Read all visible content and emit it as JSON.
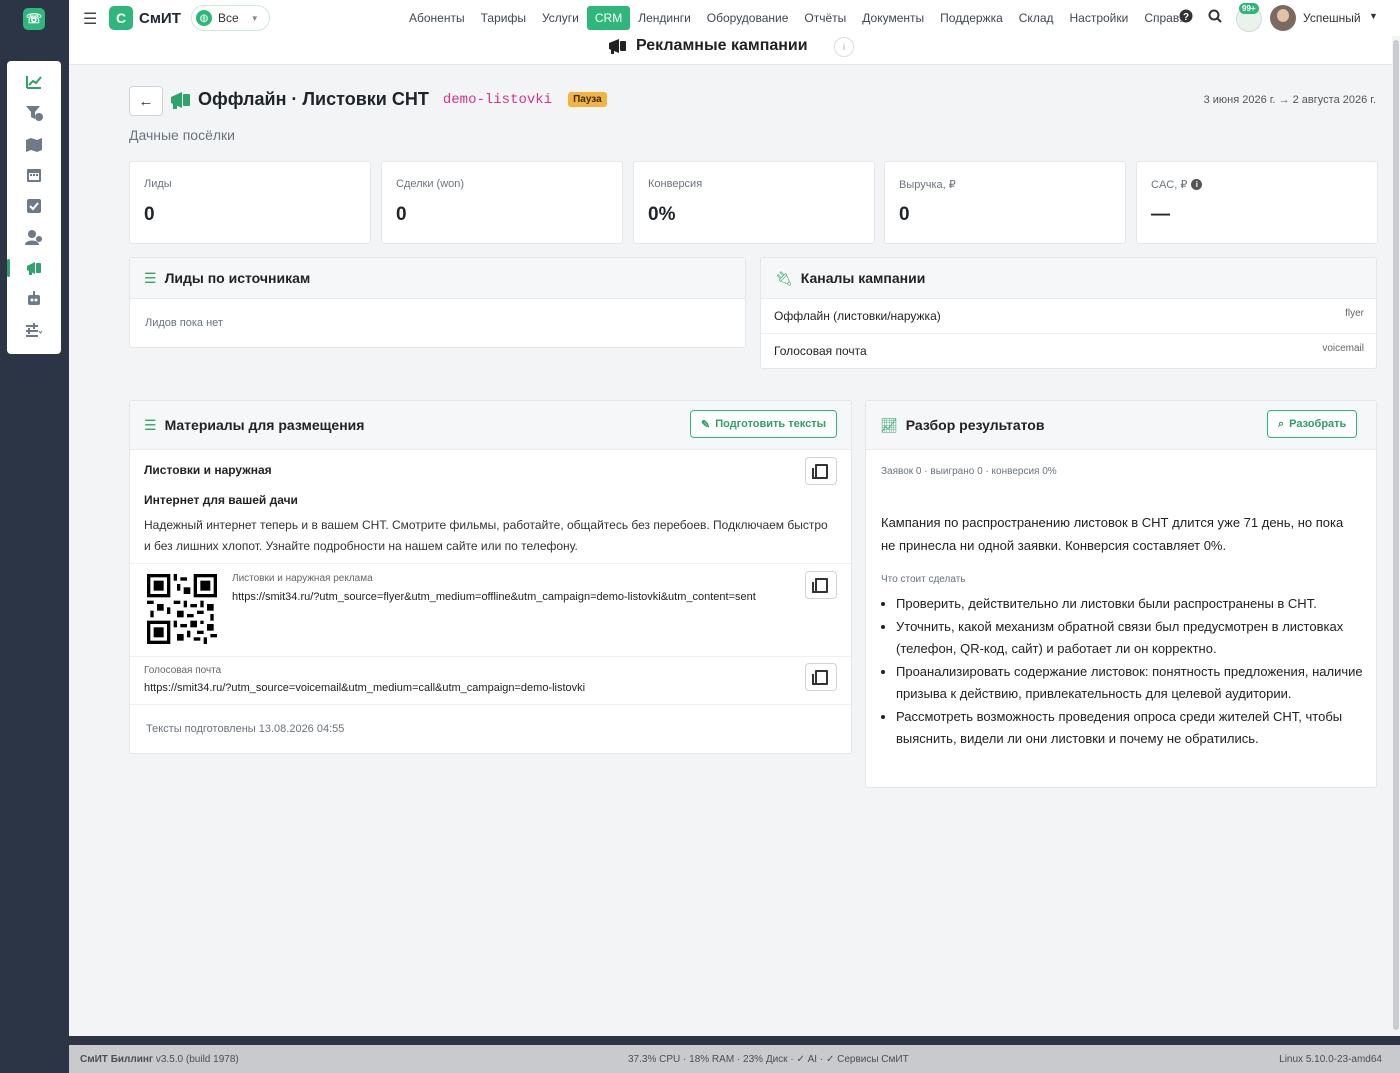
{
  "app": {
    "logo_letter": "С",
    "name": "СмИТ",
    "scope": "Все"
  },
  "nav": [
    "Абоненты",
    "Тарифы",
    "Услуги",
    "CRM",
    "Лендинги",
    "Оборудование",
    "Отчёты",
    "Документы",
    "Поддержка",
    "Склад",
    "Настройки",
    "Справ."
  ],
  "user": {
    "name": "Успешный",
    "notifications": "99+"
  },
  "page_title": "Рекламные кампании",
  "campaign": {
    "title": "Оффлайн · Листовки СНТ",
    "slug": "demo-listovki",
    "status": "Пауза",
    "dates": "3 июня 2026 г. → 2 августа 2026 г.",
    "description": "Дачные посёлки"
  },
  "kpis": [
    {
      "label": "Лиды",
      "value": "0"
    },
    {
      "label": "Сделки (won)",
      "value": "0"
    },
    {
      "label": "Конверсия",
      "value": "0%"
    },
    {
      "label": "Выручка, ₽",
      "value": "0"
    },
    {
      "label": "CAC, ₽",
      "value": "—"
    }
  ],
  "leads_by_source": {
    "title": "Лиды по источникам",
    "empty": "Лидов пока нет"
  },
  "channels": {
    "title": "Каналы кампании",
    "items": [
      {
        "name": "Оффлайн (листовки/наружка)",
        "code": "flyer"
      },
      {
        "name": "Голосовая почта",
        "code": "voicemail"
      }
    ]
  },
  "materials": {
    "title": "Материалы для размещения",
    "button": "Подготовить тексты",
    "section_title": "Листовки и наружная",
    "headline": "Интернет для вашей дачи",
    "body": "Надежный интернет теперь и в вашем СНТ. Смотрите фильмы, работайте, общайтесь без перебоев. Подключаем быстро и без лишних хлопот. Узнайте подробности на нашем сайте или по телефону.",
    "link1_label": "Листовки и наружная реклама",
    "link1_url": "https://smit34.ru/?utm_source=flyer&utm_medium=offline&utm_campaign=demo-listovki&utm_content=sent",
    "link2_label": "Голосовая почта",
    "link2_url": "https://smit34.ru/?utm_source=voicemail&utm_medium=call&utm_campaign=demo-listovki",
    "prepared": "Тексты подготовлены 13.08.2026 04:55"
  },
  "analysis": {
    "title": "Разбор результатов",
    "button": "Разобрать",
    "stats": "Заявок 0 · выиграно 0 · конверсия 0%",
    "summary": "Кампания по распространению листовок в СНТ длится уже 71 день, но пока не принесла ни одной заявки. Конверсия составляет 0%.",
    "todo_title": "Что стоит сделать",
    "todo": [
      "Проверить, действительно ли листовки были распространены в СНТ.",
      "Уточнить, какой механизм обратной связи был предусмотрен в листовках (телефон, QR-код, сайт) и работает ли он корректно.",
      "Проанализировать содержание листовок: понятность предложения, наличие призыва к действию, привлекательность для целевой аудитории.",
      "Рассмотреть возможность проведения опроса среди жителей СНТ, чтобы выяснить, видели ли они листовки и почему не обратились."
    ]
  },
  "footer": {
    "left_bold": "СмИТ Биллинг",
    "left": " v3.5.0 (build 1978)",
    "middle": "37.3% CPU · 18% RAM · 23% Диск · ✓ AI · ✓ Сервисы СмИТ",
    "right": "Linux 5.10.0-23-amd64"
  },
  "colors": {
    "accent": "#2fb77b",
    "sidebar": "#2b3545",
    "status": "#f2b441",
    "slug": "#d63384"
  }
}
